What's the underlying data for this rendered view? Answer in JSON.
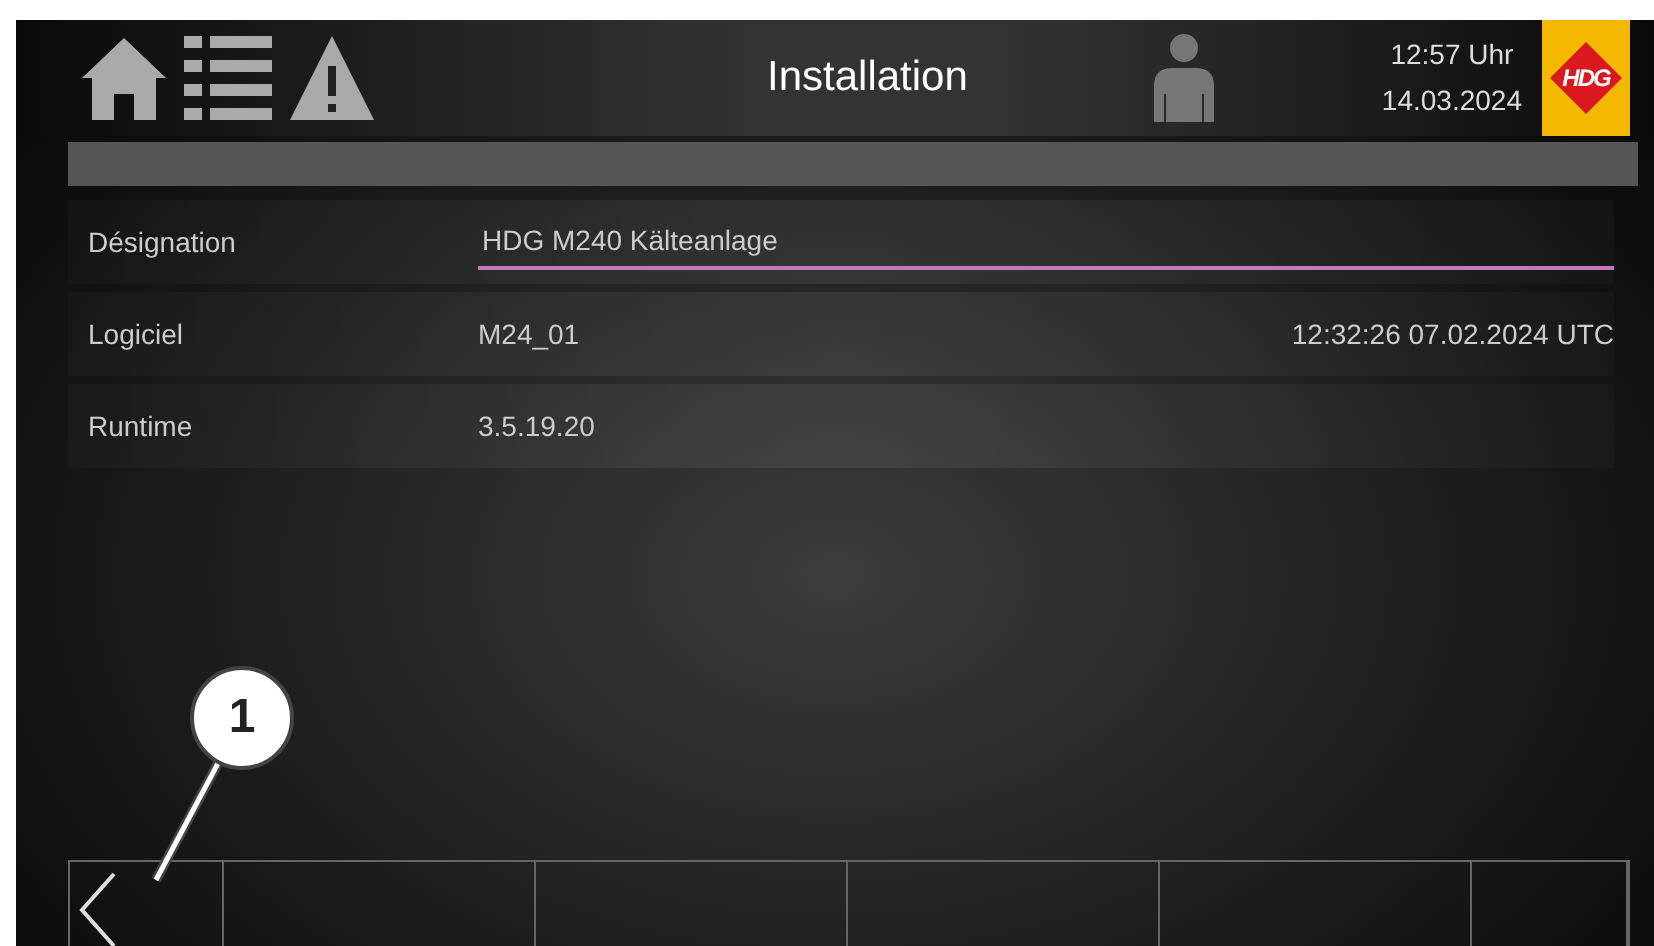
{
  "header": {
    "title": "Installation",
    "time": "12:57 Uhr",
    "date": "14.03.2024",
    "logo_text": "HDG"
  },
  "fields": [
    {
      "kind": "input",
      "label": "Désignation",
      "value": "HDG M240 Kälteanlage"
    },
    {
      "kind": "info",
      "label": "Logiciel",
      "value": "M24_01",
      "extra": "12:32:26 07.02.2024 UTC"
    },
    {
      "kind": "info",
      "label": "Runtime",
      "value": "3.5.19.20"
    }
  ],
  "footer": [
    {
      "kind": "back"
    },
    {
      "kind": "blank"
    },
    {
      "kind": "blank"
    },
    {
      "kind": "blank"
    },
    {
      "kind": "blank"
    },
    {
      "kind": "narrow"
    }
  ],
  "callout": {
    "label": "1"
  }
}
